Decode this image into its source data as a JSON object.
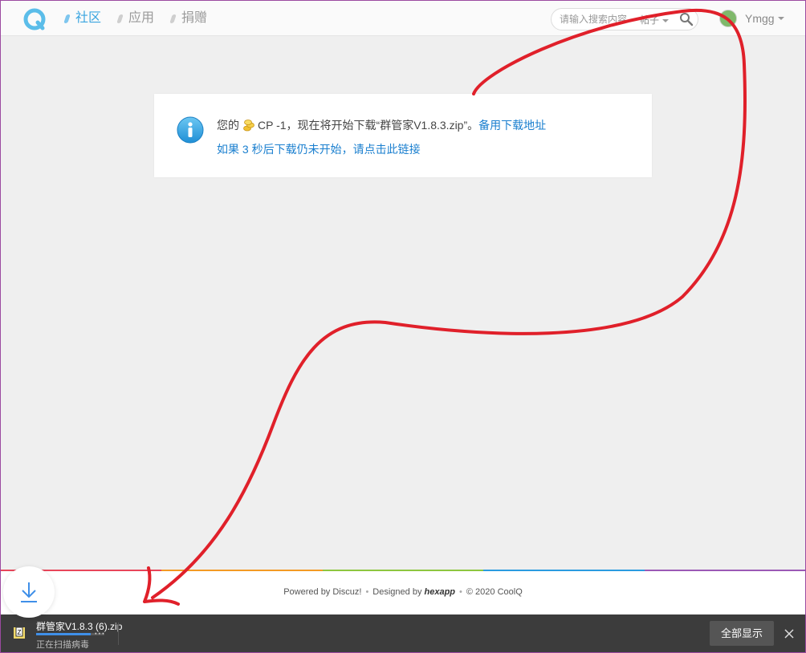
{
  "header": {
    "nav": [
      {
        "label": "社区",
        "active": true
      },
      {
        "label": "应用",
        "active": false
      },
      {
        "label": "捐赠",
        "active": false
      }
    ],
    "search": {
      "placeholder": "请输入搜索内容",
      "scope": "帖子"
    },
    "user": {
      "name": "Ymgg"
    }
  },
  "message": {
    "prefix": "您的",
    "credit": "CP -1",
    "middle": "，现在将开始下载“群管家V1.8.3.zip”。",
    "alt_link": "备用下载地址",
    "line2_before": "如果",
    "countdown": "3",
    "line2_after": "秒后下载仍未开始，请点击此链接"
  },
  "footer": {
    "powered_by": "Powered by Discuz!",
    "designed_by": "Designed by",
    "designer": "hexapp",
    "copyright": "© 2020 CoolQ",
    "rainbow_colors": [
      "#e8465a",
      "#f39a24",
      "#8dc63f",
      "#2a9be0",
      "#9b59b6"
    ]
  },
  "download_bar": {
    "filename": "群管家V1.8.3 (6).zip",
    "status": "正在扫描病毒",
    "progress": 0.8,
    "show_all": "全部显示"
  },
  "colors": {
    "accent": "#3aa5e0",
    "link": "#1a7fcf",
    "annotation": "#e0202a"
  }
}
